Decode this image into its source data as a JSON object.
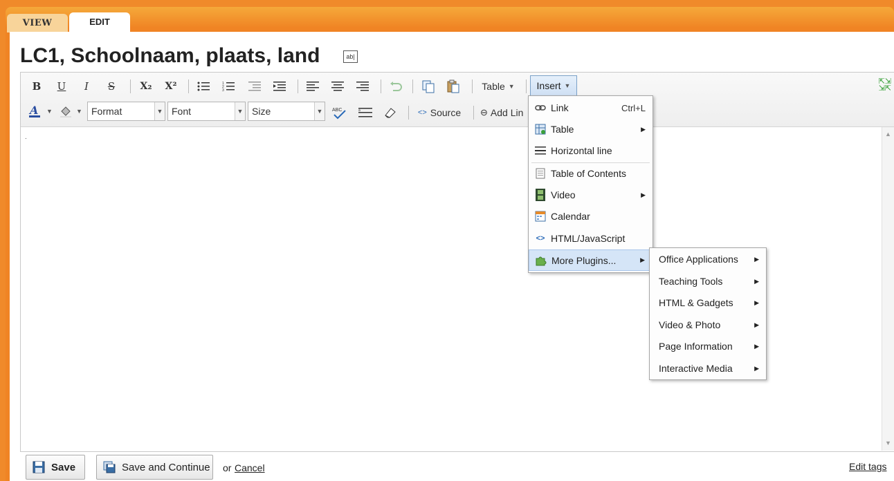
{
  "tabs": {
    "view": "VIEW",
    "edit": "EDIT"
  },
  "page": {
    "title": "LC1, Schoolnaam, plaats, land",
    "title_edit_icon": "ab|"
  },
  "toolbar": {
    "row1": {
      "bold": "B",
      "underline": "U",
      "italic": "I",
      "strike": "S",
      "subscript": "X₂",
      "superscript": "X²",
      "table_label": "Table",
      "insert_label": "Insert"
    },
    "row2": {
      "format": "Format",
      "font": "Font",
      "size": "Size",
      "source": "Source",
      "add_link": "Add Lin"
    }
  },
  "insert_menu": {
    "items": [
      {
        "label": "Link",
        "shortcut": "Ctrl+L",
        "icon": "link-icon"
      },
      {
        "label": "Table",
        "submenu": true,
        "icon": "table-icon"
      },
      {
        "label": "Horizontal line",
        "icon": "horizontal-line-icon"
      },
      {
        "label": "Table of Contents",
        "icon": "document-icon"
      },
      {
        "label": "Video",
        "submenu": true,
        "icon": "film-icon"
      },
      {
        "label": "Calendar",
        "icon": "calendar-icon"
      },
      {
        "label": "HTML/JavaScript",
        "icon": "code-icon"
      },
      {
        "label": "More Plugins...",
        "submenu": true,
        "icon": "puzzle-icon",
        "active": true
      }
    ]
  },
  "plugins_menu": {
    "items": [
      "Office Applications",
      "Teaching Tools",
      "HTML & Gadgets",
      "Video & Photo",
      "Page Information",
      "Interactive Media"
    ]
  },
  "footer": {
    "save": "Save",
    "save_continue": "Save and Continue",
    "or": "or",
    "cancel": "Cancel",
    "edit_tags": "Edit tags"
  },
  "colors": {
    "accent_orange": "#f08424",
    "menu_highlight": "#d5e5f7"
  }
}
